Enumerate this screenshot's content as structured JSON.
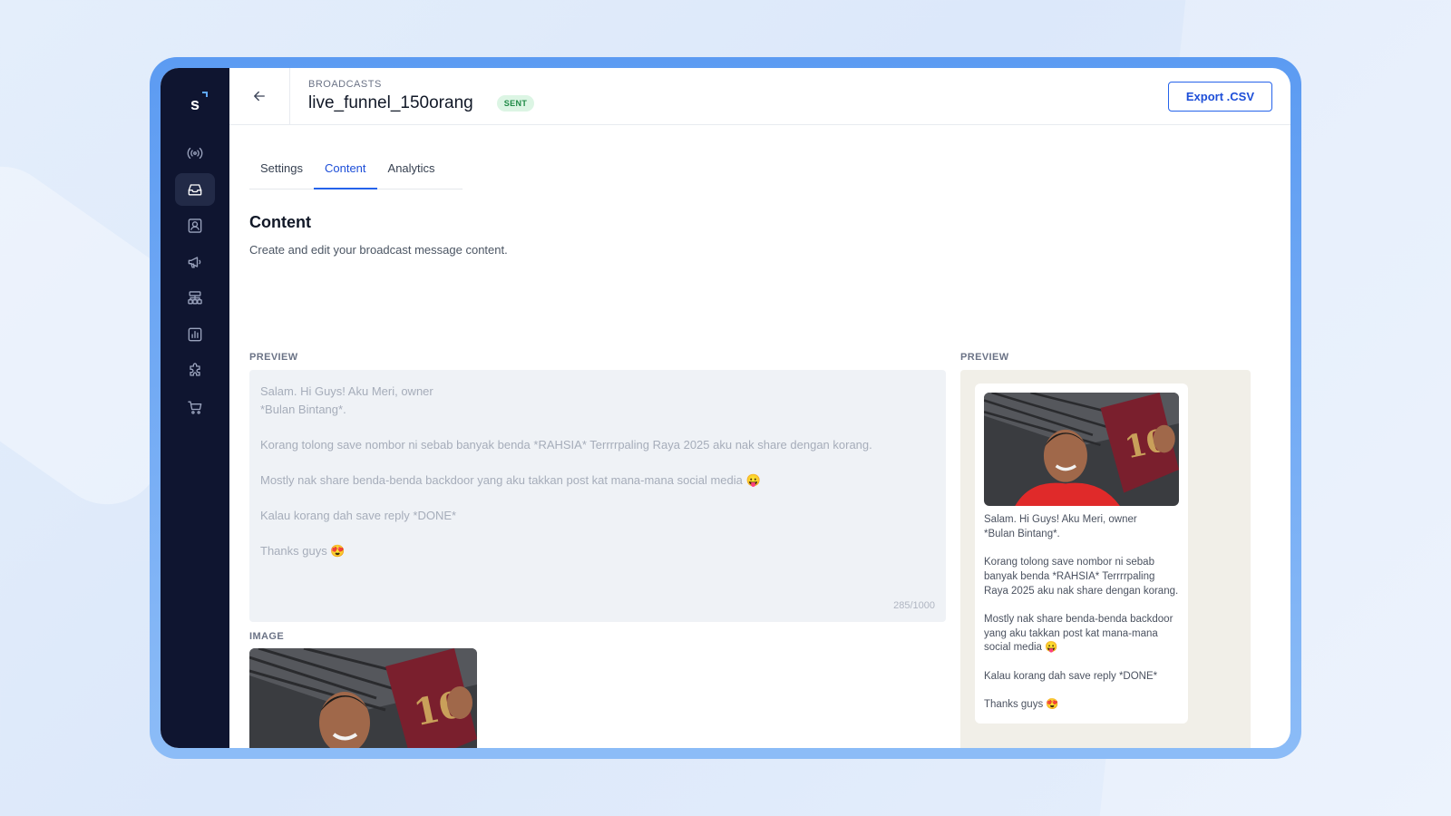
{
  "header": {
    "breadcrumb": "BROADCASTS",
    "title": "live_funnel_150orang",
    "status": "SENT",
    "export_label": "Export .CSV"
  },
  "sidebar": {
    "logo": "s",
    "items": [
      {
        "icon": "broadcast-icon",
        "active": false
      },
      {
        "icon": "inbox-icon",
        "active": true
      },
      {
        "icon": "contact-icon",
        "active": false
      },
      {
        "icon": "megaphone-icon",
        "active": false
      },
      {
        "icon": "flow-icon",
        "active": false
      },
      {
        "icon": "chart-icon",
        "active": false
      },
      {
        "icon": "puzzle-icon",
        "active": false
      },
      {
        "icon": "cart-icon",
        "active": false
      }
    ]
  },
  "tabs": [
    {
      "label": "Settings",
      "active": false
    },
    {
      "label": "Content",
      "active": true
    },
    {
      "label": "Analytics",
      "active": false
    }
  ],
  "content": {
    "title": "Content",
    "subtitle": "Create and edit your broadcast message content.",
    "preview_label": "PREVIEW",
    "message": "Salam. Hi Guys! Aku Meri, owner\n*Bulan Bintang*.\n\nKorang tolong save nombor ni sebab banyak benda *RAHSIA* Terrrrpaling Raya 2025 aku nak share dengan korang.\n\nMostly nak share benda-benda backdoor yang aku takkan post kat mana-mana social media 😛\n\nKalau korang dah save reply *DONE*\n\nThanks guys 😍",
    "char_count": "285/1000",
    "image_label": "IMAGE"
  },
  "preview": {
    "label": "PREVIEW",
    "message": "Salam. Hi Guys! Aku Meri, owner\n*Bulan Bintang*.\n\nKorang tolong save nombor ni sebab banyak benda *RAHSIA* Terrrrpaling Raya 2025 aku nak share dengan korang.\n\nMostly nak share benda-benda backdoor yang aku takkan post kat mana-mana social media 😛\n\nKalau korang dah save reply *DONE*\n\nThanks guys 😍"
  },
  "colors": {
    "accent": "#2563eb",
    "sidebar": "#0f1530",
    "frame": "#5c9bf2",
    "badge_bg": "#dcf5e4",
    "badge_text": "#1f8a46"
  }
}
